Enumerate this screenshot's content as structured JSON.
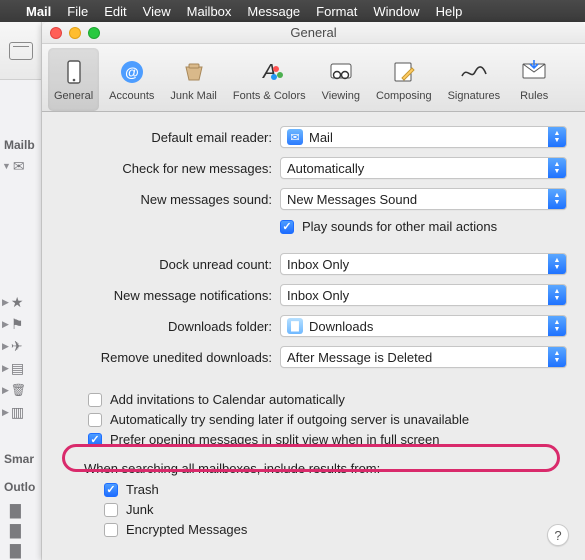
{
  "menubar": {
    "app": "Mail",
    "items": [
      "File",
      "Edit",
      "View",
      "Mailbox",
      "Message",
      "Format",
      "Window",
      "Help"
    ]
  },
  "bg": {
    "mailboxes_label": "Mailb",
    "smart_label": "Smar",
    "outlook_label": "Outlo"
  },
  "prefs": {
    "title": "General",
    "toolbar": [
      {
        "id": "general",
        "label": "General"
      },
      {
        "id": "accounts",
        "label": "Accounts"
      },
      {
        "id": "junk",
        "label": "Junk Mail"
      },
      {
        "id": "fonts",
        "label": "Fonts & Colors"
      },
      {
        "id": "viewing",
        "label": "Viewing"
      },
      {
        "id": "composing",
        "label": "Composing"
      },
      {
        "id": "signatures",
        "label": "Signatures"
      },
      {
        "id": "rules",
        "label": "Rules"
      }
    ],
    "labels": {
      "default_reader": "Default email reader:",
      "check_messages": "Check for new messages:",
      "new_sound": "New messages sound:",
      "play_sounds": "Play sounds for other mail actions",
      "dock_count": "Dock unread count:",
      "notifications": "New message notifications:",
      "downloads": "Downloads folder:",
      "remove_downloads": "Remove unedited downloads:",
      "add_invitations": "Add invitations to Calendar automatically",
      "auto_retry": "Automatically try sending later if outgoing server is unavailable",
      "split_view": "Prefer opening messages in split view when in full screen",
      "search_heading": "When searching all mailboxes, include results from:",
      "trash": "Trash",
      "junk_box": "Junk",
      "encrypted": "Encrypted Messages"
    },
    "values": {
      "default_reader": "Mail",
      "check_messages": "Automatically",
      "new_sound": "New Messages Sound",
      "dock_count": "Inbox Only",
      "notifications": "Inbox Only",
      "downloads": "Downloads",
      "remove_downloads": "After Message is Deleted"
    },
    "checks": {
      "play_sounds": true,
      "add_invitations": false,
      "auto_retry": false,
      "split_view": true,
      "trash": true,
      "junk_box": false,
      "encrypted": false
    },
    "help": "?"
  }
}
